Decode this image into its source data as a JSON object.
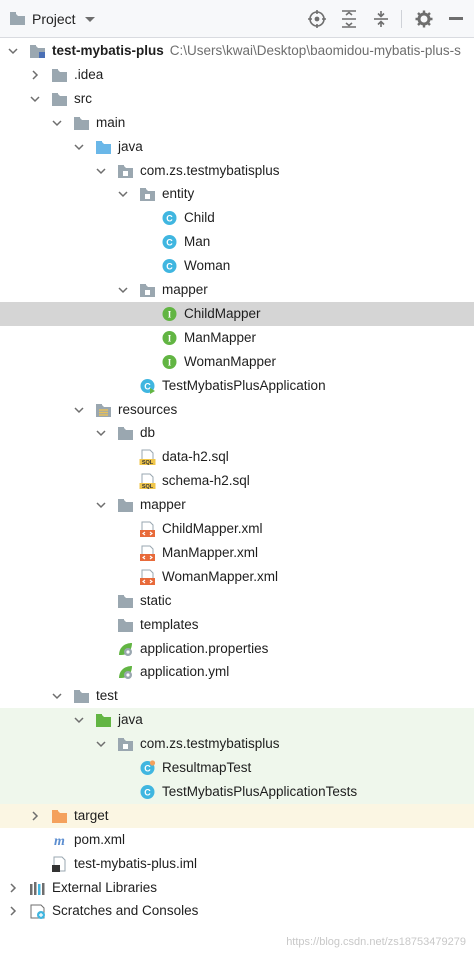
{
  "toolbar": {
    "title": "Project",
    "buttons": [
      "locate-icon",
      "expand-all-icon",
      "collapse-all-icon",
      "settings-icon",
      "hide-icon"
    ]
  },
  "tree": [
    {
      "label": "test-mybatis-plus",
      "path": "C:\\Users\\kwai\\Desktop\\baomidou-mybatis-plus-s",
      "depth": 0,
      "arrow": "down",
      "icon": "module-folder-icon",
      "bold": true
    },
    {
      "label": ".idea",
      "depth": 1,
      "arrow": "right",
      "icon": "folder-icon"
    },
    {
      "label": "src",
      "depth": 1,
      "arrow": "down",
      "icon": "folder-icon"
    },
    {
      "label": "main",
      "depth": 2,
      "arrow": "down",
      "icon": "folder-icon"
    },
    {
      "label": "java",
      "depth": 3,
      "arrow": "down",
      "icon": "source-folder-icon"
    },
    {
      "label": "com.zs.testmybatisplus",
      "depth": 4,
      "arrow": "down",
      "icon": "package-icon"
    },
    {
      "label": "entity",
      "depth": 5,
      "arrow": "down",
      "icon": "package-icon"
    },
    {
      "label": "Child",
      "depth": 6,
      "icon": "class-icon"
    },
    {
      "label": "Man",
      "depth": 6,
      "icon": "class-icon"
    },
    {
      "label": "Woman",
      "depth": 6,
      "icon": "class-icon"
    },
    {
      "label": "mapper",
      "depth": 5,
      "arrow": "down",
      "icon": "package-icon"
    },
    {
      "label": "ChildMapper",
      "depth": 6,
      "icon": "interface-icon",
      "selected": true
    },
    {
      "label": "ManMapper",
      "depth": 6,
      "icon": "interface-icon"
    },
    {
      "label": "WomanMapper",
      "depth": 6,
      "icon": "interface-icon"
    },
    {
      "label": "TestMybatisPlusApplication",
      "depth": 5,
      "icon": "spring-boot-class-icon"
    },
    {
      "label": "resources",
      "depth": 3,
      "arrow": "down",
      "icon": "resources-folder-icon"
    },
    {
      "label": "db",
      "depth": 4,
      "arrow": "down",
      "icon": "folder-icon"
    },
    {
      "label": "data-h2.sql",
      "depth": 5,
      "icon": "sql-file-icon"
    },
    {
      "label": "schema-h2.sql",
      "depth": 5,
      "icon": "sql-file-icon"
    },
    {
      "label": "mapper",
      "depth": 4,
      "arrow": "down",
      "icon": "folder-icon"
    },
    {
      "label": "ChildMapper.xml",
      "depth": 5,
      "icon": "xml-file-icon"
    },
    {
      "label": "ManMapper.xml",
      "depth": 5,
      "icon": "xml-file-icon"
    },
    {
      "label": "WomanMapper.xml",
      "depth": 5,
      "icon": "xml-file-icon"
    },
    {
      "label": "static",
      "depth": 4,
      "icon": "folder-icon"
    },
    {
      "label": "templates",
      "depth": 4,
      "icon": "folder-icon"
    },
    {
      "label": "application.properties",
      "depth": 4,
      "icon": "spring-config-icon"
    },
    {
      "label": "application.yml",
      "depth": 4,
      "icon": "spring-config-icon"
    },
    {
      "label": "test",
      "depth": 2,
      "arrow": "down",
      "icon": "folder-icon"
    },
    {
      "label": "java",
      "depth": 3,
      "arrow": "down",
      "icon": "test-folder-icon",
      "bg": "test"
    },
    {
      "label": "com.zs.testmybatisplus",
      "depth": 4,
      "arrow": "down",
      "icon": "package-icon",
      "bg": "test"
    },
    {
      "label": "ResultmapTest",
      "depth": 5,
      "icon": "test-class-icon",
      "bg": "test"
    },
    {
      "label": "TestMybatisPlusApplicationTests",
      "depth": 5,
      "icon": "class-icon",
      "bg": "test"
    },
    {
      "label": "target",
      "depth": 1,
      "arrow": "right",
      "icon": "excluded-folder-icon",
      "bg": "excluded"
    },
    {
      "label": "pom.xml",
      "depth": 1,
      "icon": "maven-icon"
    },
    {
      "label": "test-mybatis-plus.iml",
      "depth": 1,
      "icon": "iml-file-icon"
    },
    {
      "label": "External Libraries",
      "depth": 0,
      "arrow": "right",
      "icon": "libraries-icon"
    },
    {
      "label": "Scratches and Consoles",
      "depth": 0,
      "arrow": "right",
      "icon": "scratches-icon"
    }
  ],
  "watermark": "https://blog.csdn.net/zs18753479279",
  "colors": {
    "folder": "#9aa7b0",
    "source_folder": "#6ab7e8",
    "test_folder": "#62b543",
    "excluded_folder": "#f4a15d",
    "class_badge": "#40b6e0",
    "interface_badge": "#62b543",
    "selected_bg": "#d5d5d5",
    "test_bg": "#eff7ec",
    "excluded_bg": "#fbf6e3"
  }
}
